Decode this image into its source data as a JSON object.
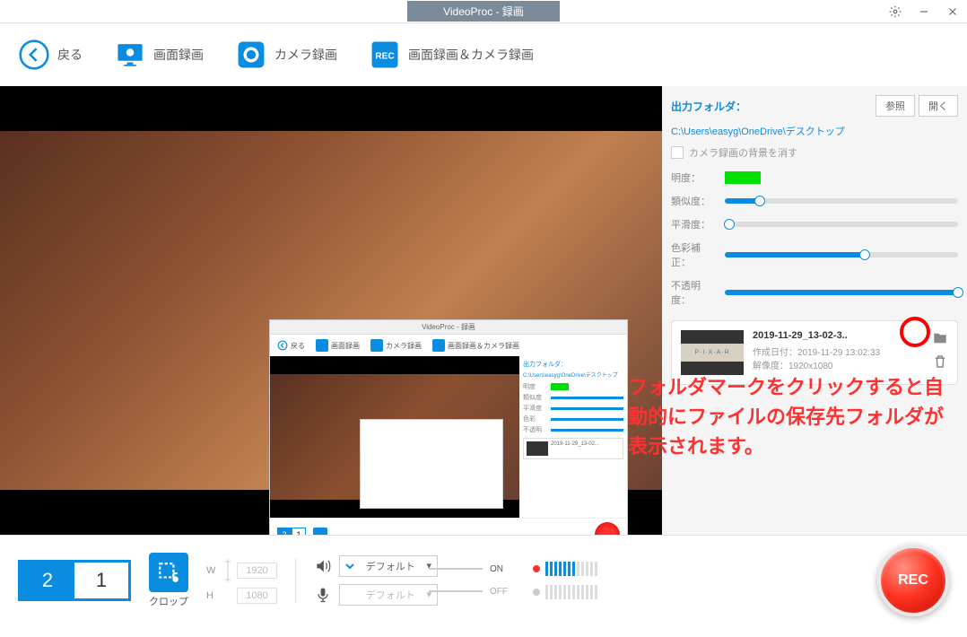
{
  "title": "VideoProc - 録画",
  "toolbar": {
    "back": "戻る",
    "screen_rec": "画面録画",
    "camera_rec": "カメラ録画",
    "both_rec": "画面録画＆カメラ録画"
  },
  "sidebar": {
    "output_label": "出力フォルダ：",
    "browse": "参照",
    "open": "開く",
    "path": "C:\\Users\\easyg\\OneDrive\\デスクトップ",
    "erase_bg": "カメラ録画の背景を消す",
    "sliders": {
      "brightness": "明度：",
      "similarity": "類似度：",
      "smoothness": "平滑度：",
      "color_correct": "色彩補正：",
      "opacity": "不透明度："
    },
    "slider_values": {
      "similarity": 15,
      "smoothness": 0,
      "color_correct": 60,
      "opacity": 100
    },
    "file": {
      "name": "2019-11-29_13-02-3..",
      "created_label": "作成日付：",
      "created": "2019-11-29 13:02:33",
      "resolution_label": "解像度：",
      "resolution": "1920x1080",
      "thumb_text": "P·I·X·A·R"
    }
  },
  "annotation": "フォルダマークをクリックすると自動的にファイルの保存先フォルダが表示されます。",
  "bottom": {
    "monitors": [
      "2",
      "1"
    ],
    "active_monitor": 0,
    "crop": "クロップ",
    "width_label": "W",
    "height_label": "H",
    "width": "1920",
    "height": "1080",
    "audio_default": "デフォルト",
    "on": "ON",
    "off": "OFF",
    "rec": "REC"
  },
  "nested": {
    "title": "VideoProc - 録画",
    "back": "戻る",
    "screen_rec": "画面録画",
    "camera_rec": "カメラ録画",
    "both_rec": "画面録画＆カメラ録画"
  }
}
